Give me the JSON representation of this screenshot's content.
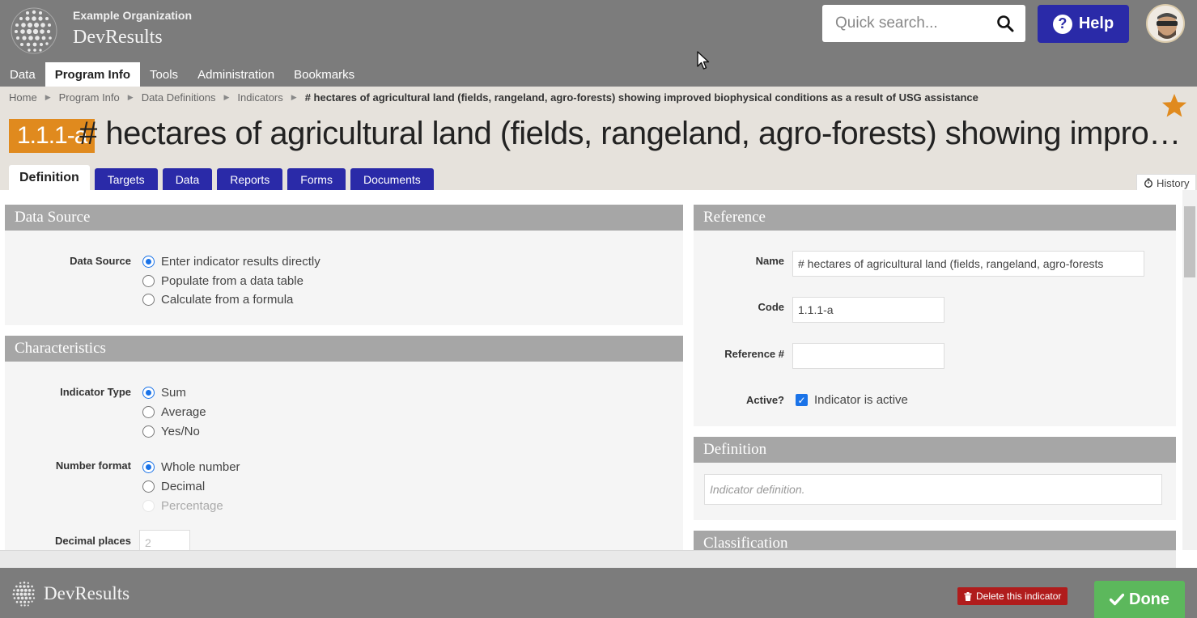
{
  "header": {
    "org_name": "Example Organization",
    "app_name": "DevResults",
    "search_placeholder": "Quick search...",
    "help_label": "Help",
    "help_glyph": "?"
  },
  "nav": {
    "items": [
      {
        "label": "Data",
        "active": false
      },
      {
        "label": "Program Info",
        "active": true
      },
      {
        "label": "Tools",
        "active": false
      },
      {
        "label": "Administration",
        "active": false
      },
      {
        "label": "Bookmarks",
        "active": false
      }
    ]
  },
  "breadcrumb": {
    "items": [
      "Home",
      "Program Info",
      "Data Definitions",
      "Indicators"
    ],
    "current": "# hectares of agricultural land (fields, rangeland, agro-forests) showing improved biophysical conditions as a result of USG assistance"
  },
  "indicator": {
    "code": "1.1.1-a",
    "title": "# hectares of agricultural land (fields, rangeland, agro-forests) showing improved biophysical conditions as a result of USG assistance"
  },
  "tabs": {
    "items": [
      "Definition",
      "Targets",
      "Data",
      "Reports",
      "Forms",
      "Documents"
    ],
    "active": "Definition",
    "history_label": "History"
  },
  "data_source": {
    "title": "Data Source",
    "label": "Data Source",
    "options": [
      "Enter indicator results directly",
      "Populate from a data table",
      "Calculate from a formula"
    ],
    "selected": 0
  },
  "characteristics": {
    "title": "Characteristics",
    "indicator_type_label": "Indicator Type",
    "indicator_type_options": [
      "Sum",
      "Average",
      "Yes/No"
    ],
    "indicator_type_selected": 0,
    "number_format_label": "Number format",
    "number_format_options": [
      "Whole number",
      "Decimal",
      "Percentage"
    ],
    "number_format_selected": 0,
    "decimal_places_label": "Decimal places",
    "decimal_places_value": "2"
  },
  "reference": {
    "title": "Reference",
    "name_label": "Name",
    "name_value": "# hectares of agricultural land (fields, rangeland, agro-forests",
    "code_label": "Code",
    "code_value": "1.1.1-a",
    "reference_label": "Reference #",
    "reference_value": "",
    "active_label": "Active?",
    "active_text": "Indicator is active",
    "active_checked": true
  },
  "definition": {
    "title": "Definition",
    "placeholder": "Indicator definition."
  },
  "classification": {
    "title": "Classification"
  },
  "footer": {
    "app_name": "DevResults",
    "delete_label": "Delete this indicator",
    "done_label": "Done"
  },
  "colors": {
    "header_bg": "#7c7c7c",
    "primary_blue": "#2a2aa8",
    "badge_orange": "#e08a1e",
    "done_green": "#5cb85c",
    "delete_red": "#b01c1c",
    "star": "#e08a1e"
  }
}
